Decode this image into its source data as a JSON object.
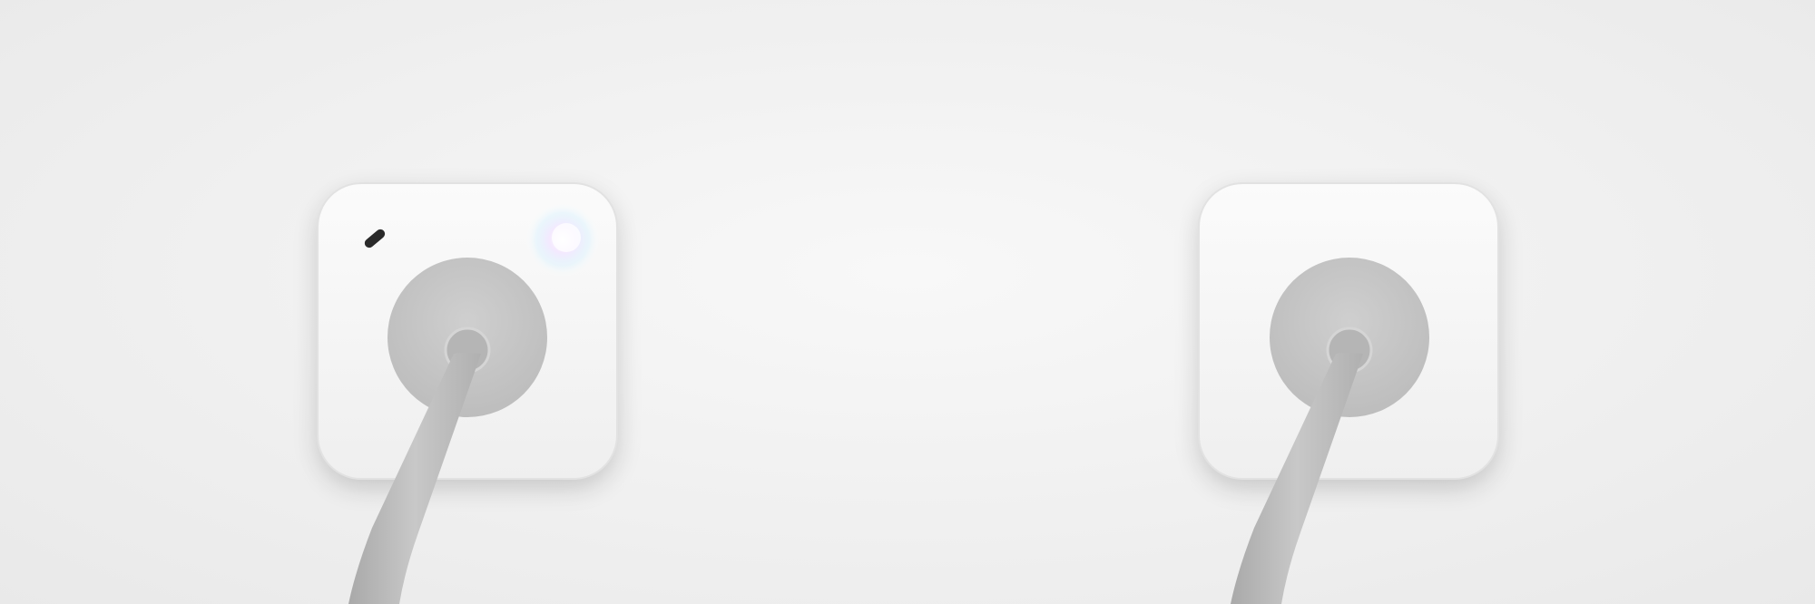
{
  "scene": {
    "description_label": "",
    "colors": {
      "wall": "#efefef",
      "plate": "#f6f6f6",
      "plate_shadow": "#d9d9d9",
      "socket": "#c6c6c6",
      "cable": "#bdbdbd",
      "led_glow": "#e6d8ff",
      "indicator": "#2a2a2a"
    }
  },
  "devices": [
    {
      "name": "smart-plug-left",
      "has_led_glow": true,
      "has_indicator": true
    },
    {
      "name": "smart-plug-right",
      "has_led_glow": false,
      "has_indicator": false
    }
  ]
}
